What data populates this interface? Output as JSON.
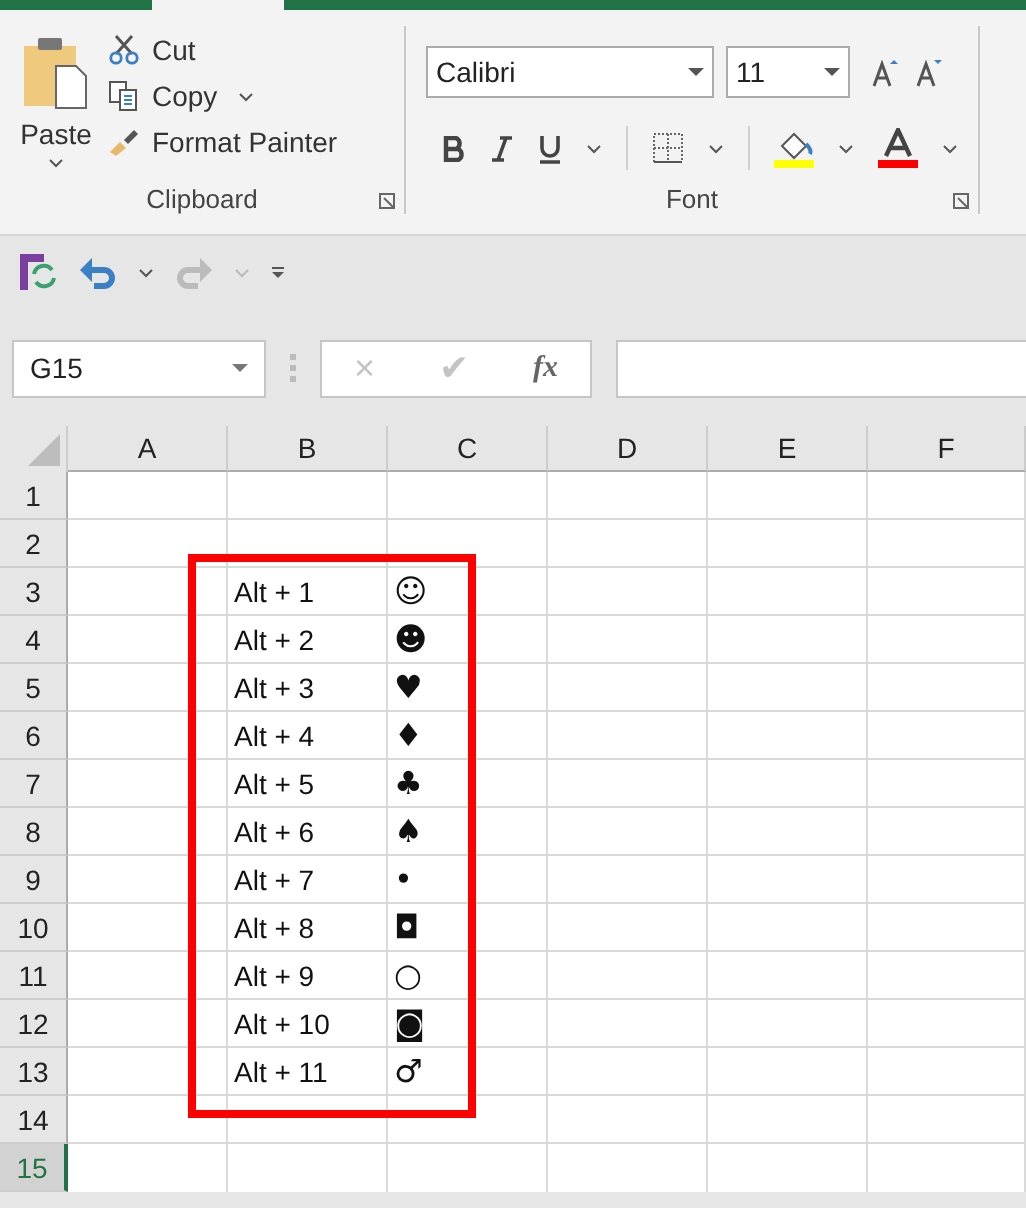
{
  "ribbon": {
    "clipboard": {
      "paste": "Paste",
      "cut": "Cut",
      "copy": "Copy",
      "format_painter": "Format Painter",
      "label": "Clipboard"
    },
    "font": {
      "name": "Calibri",
      "size": "11",
      "label": "Font"
    }
  },
  "formula_bar": {
    "name_box": "G15",
    "cancel": "×",
    "enter": "✔",
    "fx": "fx"
  },
  "columns": [
    "A",
    "B",
    "C",
    "D",
    "E",
    "F"
  ],
  "rows": [
    {
      "number": "1",
      "selected": false
    },
    {
      "number": "2",
      "selected": false
    },
    {
      "number": "3",
      "selected": false,
      "b": "Alt + 1",
      "c": "☺"
    },
    {
      "number": "4",
      "selected": false,
      "b": "Alt + 2",
      "c": "☻"
    },
    {
      "number": "5",
      "selected": false,
      "b": "Alt + 3",
      "c": "♥"
    },
    {
      "number": "6",
      "selected": false,
      "b": "Alt + 4",
      "c": "♦"
    },
    {
      "number": "7",
      "selected": false,
      "b": "Alt + 5",
      "c": "♣"
    },
    {
      "number": "8",
      "selected": false,
      "b": "Alt + 6",
      "c": "♠"
    },
    {
      "number": "9",
      "selected": false,
      "b": "Alt + 7",
      "c": "•"
    },
    {
      "number": "10",
      "selected": false,
      "b": "Alt + 8",
      "c": "◘"
    },
    {
      "number": "11",
      "selected": false,
      "b": "Alt + 9",
      "c": "○"
    },
    {
      "number": "12",
      "selected": false,
      "b": "Alt + 10",
      "c": "◙"
    },
    {
      "number": "13",
      "selected": false,
      "b": "Alt + 11",
      "c": "♂"
    },
    {
      "number": "14",
      "selected": false
    },
    {
      "number": "15",
      "selected": true
    }
  ]
}
